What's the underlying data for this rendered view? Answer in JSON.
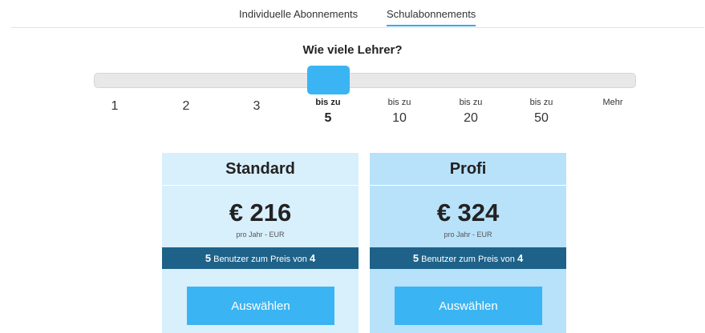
{
  "tabs": [
    {
      "label": "Individuelle Abonnements",
      "active": false
    },
    {
      "label": "Schulabonnements",
      "active": true
    }
  ],
  "question": "Wie viele Lehrer?",
  "slider": {
    "selected": "bis zu 5",
    "ticks": [
      {
        "top": "",
        "value": "1"
      },
      {
        "top": "",
        "value": "2"
      },
      {
        "top": "",
        "value": "3"
      },
      {
        "top": "bis zu",
        "value": "5"
      },
      {
        "top": "bis zu",
        "value": "10"
      },
      {
        "top": "bis zu",
        "value": "20"
      },
      {
        "top": "bis zu",
        "value": "50"
      },
      {
        "top": "Mehr",
        "value": ""
      }
    ]
  },
  "plans": [
    {
      "name": "Standard",
      "price": "€ 216",
      "period": "pro Jahr - EUR",
      "offer_count": "5",
      "offer_text": " Benutzer zum Preis von ",
      "offer_price": "4",
      "button": "Auswählen",
      "color": "#d8effc"
    },
    {
      "name": "Profi",
      "price": "€ 324",
      "period": "pro Jahr - EUR",
      "offer_count": "5",
      "offer_text": " Benutzer zum Preis von ",
      "offer_price": "4",
      "button": "Auswählen",
      "color": "#b8e1fa"
    }
  ],
  "colors": {
    "accent": "#3ab4f2",
    "offer_bar": "#1e6289"
  }
}
